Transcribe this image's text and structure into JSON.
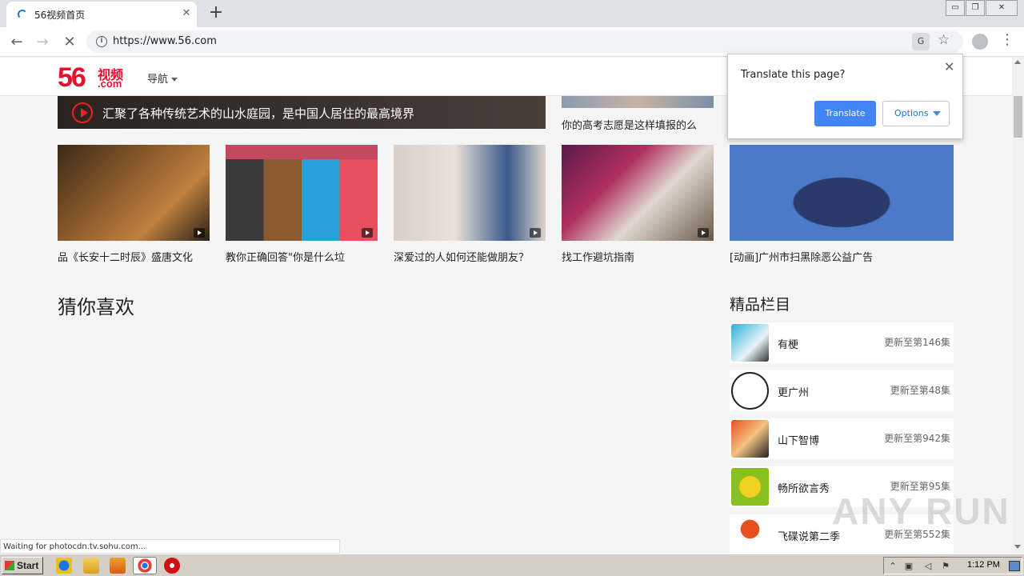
{
  "browser": {
    "tab_title": "56视频首页",
    "tab_close": "✕",
    "new_tab": "+",
    "url": "https://www.56.com",
    "window_controls": {
      "minimize": "▭",
      "maximize": "❐",
      "close": "✕"
    }
  },
  "site": {
    "logo_number": "56",
    "logo_cn": "视频",
    "logo_com": ".com",
    "nav_label": "导航",
    "feature_title": "汇聚了各种传统艺术的山水庭园，是中国人居住的最高境界",
    "top_right_caption": "你的高考志愿是这样填报的么",
    "videos": [
      {
        "caption": "品《长安十二时辰》盛唐文化"
      },
      {
        "caption": "教你正确回答\"你是什么垃"
      },
      {
        "caption": "深爱过的人如何还能做朋友？"
      },
      {
        "caption": "找工作避坑指南"
      },
      {
        "caption": "[动画]广州市扫黑除恶公益广告"
      }
    ],
    "section_title": "猜你喜欢",
    "side_title": "精品栏目",
    "series": [
      {
        "name": "有梗",
        "update": "更新至第146集"
      },
      {
        "name": "更广州",
        "update": "更新至第48集"
      },
      {
        "name": "山下智博",
        "update": "更新至第942集"
      },
      {
        "name": "畅所欲言秀",
        "update": "更新至第95集"
      },
      {
        "name": "飞碟说第二季",
        "update": "更新至第552集"
      }
    ]
  },
  "translate_popup": {
    "title": "Translate this page?",
    "close": "✕",
    "translate_button": "Translate",
    "options_button": "Options"
  },
  "status_text": "Waiting for photocdn.tv.sohu.com...",
  "watermark": "ANY RUN",
  "taskbar": {
    "start_label": "Start",
    "clock": "1:12 PM"
  },
  "colors": {
    "brand_red": "#e8102c",
    "translate_blue": "#4285f4"
  }
}
